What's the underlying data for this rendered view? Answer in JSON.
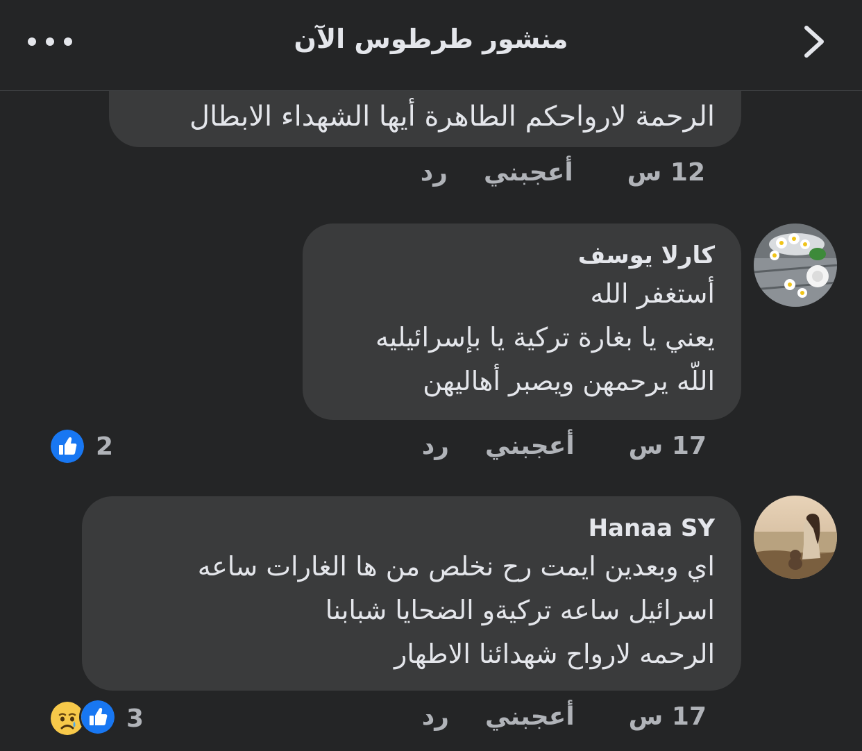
{
  "header": {
    "title": "منشور طرطوس الآن",
    "more_icon": "more-horizontal-icon",
    "back_icon": "chevron-right-icon"
  },
  "comments": [
    {
      "text_lines": [
        "الرحمة لارواحكم الطاهرة أيها الشهداء الابطال"
      ],
      "time": "12 س",
      "like_label": "أعجبني",
      "reply_label": "رد"
    },
    {
      "author": "كارلا يوسف",
      "text_lines": [
        "أستغفر الله",
        "يعني يا بغارة تركية يا بإسرائيليه",
        "اللّه يرحمهن ويصبر أهاليهن"
      ],
      "time": "17 س",
      "like_label": "أعجبني",
      "reply_label": "رد",
      "reaction_count": "2",
      "reactions": [
        "like-icon"
      ]
    },
    {
      "author": "Hanaa SY",
      "text_lines": [
        "اي وبعدين ايمت رح نخلص من ها الغارات ساعه",
        "اسرائيل ساعه تركيةو الضحايا شبابنا",
        "الرحمه لارواح شهدائنا الاطهار"
      ],
      "time": "17 س",
      "like_label": "أعجبني",
      "reply_label": "رد",
      "reaction_count": "3",
      "reactions": [
        "sad-icon",
        "like-icon"
      ]
    }
  ],
  "colors": {
    "background": "#242526",
    "bubble": "#3a3b3c",
    "text_primary": "#e4e6eb",
    "text_secondary": "#b0b3b8",
    "like_blue": "#1877f2",
    "sad_yellow": "#f7c94a"
  }
}
